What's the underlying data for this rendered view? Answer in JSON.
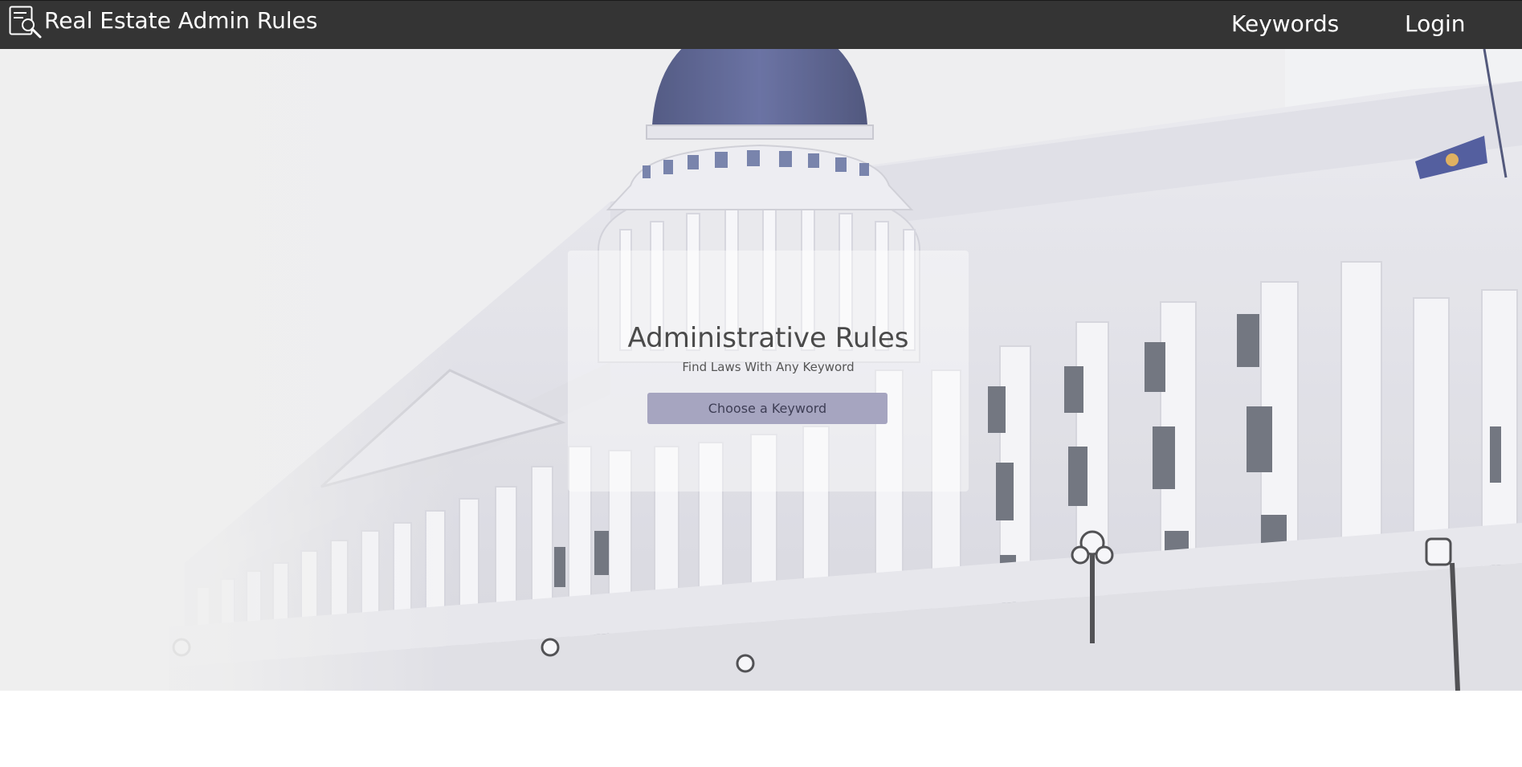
{
  "nav": {
    "brand_label": "Real Estate Admin Rules",
    "brand_icon": "document-search-icon",
    "links": [
      {
        "label": "Keywords"
      },
      {
        "label": "Login"
      }
    ]
  },
  "hero": {
    "background": "capitol-building-photo",
    "title": "Administrative Rules",
    "subtitle": "Find Laws With Any Keyword",
    "button_label": "Choose a Keyword"
  },
  "colors": {
    "navbar": "#343434",
    "button": "#a6a5c0",
    "dome": "#3d4677"
  }
}
